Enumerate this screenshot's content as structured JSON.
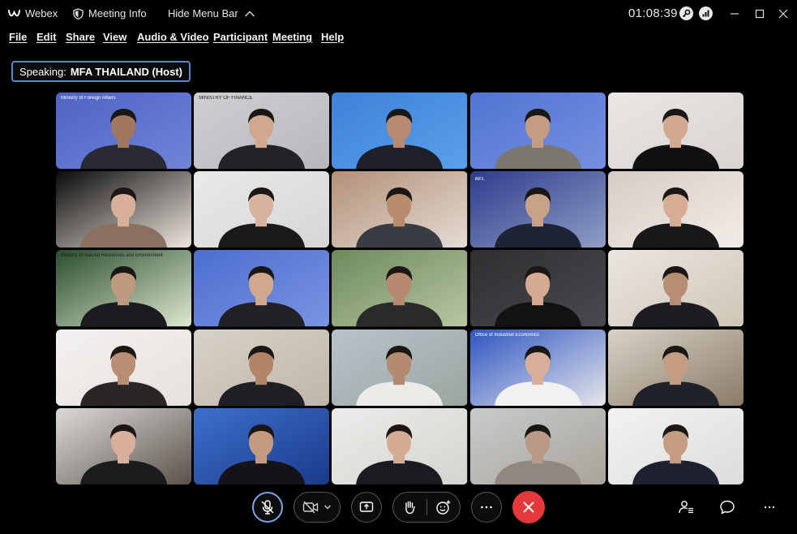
{
  "titlebar": {
    "app_name": "Webex",
    "meeting_info": "Meeting Info",
    "hide_menu_bar": "Hide Menu Bar",
    "elapsed": "01:08:39"
  },
  "menu": [
    "File",
    "Edit",
    "Share",
    "View",
    "Audio & Video",
    "Participant",
    "Meeting",
    "Help"
  ],
  "speaking": {
    "label": "Speaking:",
    "name": "MFA THAILAND (Host)"
  },
  "colors": {
    "accent": "#5b86c8",
    "end_call": "#e5383b",
    "background": "#000000"
  },
  "tiles": [
    {
      "bg": "#4f63c4",
      "bg2": "#6f85d8",
      "face": "#a07860",
      "suit": "#2a2a34",
      "banner": "Ministry of Foreign Affairs"
    },
    {
      "bg": "#cfcfd2",
      "bg2": "#b7b8bc",
      "face": "#d0a890",
      "suit": "#222228",
      "banner": "MINISTRY OF FINANCE"
    },
    {
      "bg": "#3d82d8",
      "bg2": "#5aa0ea",
      "face": "#b88a70",
      "suit": "#20202a",
      "banner": ""
    },
    {
      "bg": "#5174d2",
      "bg2": "#7590e0",
      "face": "#c49c84",
      "suit": "#7a7670",
      "banner": ""
    },
    {
      "bg": "#e9e6e4",
      "bg2": "#d8d4d0",
      "face": "#d2a890",
      "suit": "#111114",
      "banner": ""
    },
    {
      "bg": "#0a0a0a",
      "bg2": "#efe7df",
      "face": "#d8b09a",
      "suit": "#8a7060",
      "banner": ""
    },
    {
      "bg": "#e9e9ea",
      "bg2": "#d6d6d8",
      "face": "#d8b29c",
      "suit": "#1a1a1a",
      "banner": ""
    },
    {
      "bg": "#b39078",
      "bg2": "#e4dcd3",
      "face": "#b88b6c",
      "suit": "#3a3c44",
      "banner": ""
    },
    {
      "bg": "#2e3c8e",
      "bg2": "#8f9fc4",
      "face": "#c8a288",
      "suit": "#1e2434",
      "banner": "สสว."
    },
    {
      "bg": "#d6ccc4",
      "bg2": "#f2ece8",
      "face": "#d6ad94",
      "suit": "#181818",
      "banner": ""
    },
    {
      "bg": "#2a4d2e",
      "bg2": "#dde8d0",
      "face": "#c09a80",
      "suit": "#1a1c22",
      "banner": "Ministry of Natural Resources and Environment"
    },
    {
      "bg": "#4d6ed0",
      "bg2": "#7a94e2",
      "face": "#d0a88e",
      "suit": "#222226",
      "banner": ""
    },
    {
      "bg": "#6d8a5a",
      "bg2": "#b8c6a4",
      "face": "#b58a6e",
      "suit": "#2a2a2a",
      "banner": ""
    },
    {
      "bg": "#2f2f32",
      "bg2": "#4a4a4e",
      "face": "#d4aa92",
      "suit": "#121214",
      "banner": ""
    },
    {
      "bg": "#eae6e0",
      "bg2": "#cfc5b6",
      "face": "#b88e72",
      "suit": "#1c1c22",
      "banner": ""
    },
    {
      "bg": "#f3f1f0",
      "bg2": "#e5e1dd",
      "face": "#b88e74",
      "suit": "#2a2628",
      "banner": ""
    },
    {
      "bg": "#d7d2c8",
      "bg2": "#bfb6a8",
      "face": "#b28568",
      "suit": "#1e2024",
      "banner": ""
    },
    {
      "bg": "#b8c2cc",
      "bg2": "#9aa6a0",
      "face": "#b48a70",
      "suit": "#ecebe8",
      "banner": ""
    },
    {
      "bg": "#2e55c2",
      "bg2": "#e6e6ea",
      "face": "#d8b09a",
      "suit": "#f2f2f2",
      "banner": "Office of Industrial Economics"
    },
    {
      "bg": "#d8d2c8",
      "bg2": "#8a7a66",
      "face": "#c49c82",
      "suit": "#20222a",
      "banner": ""
    },
    {
      "bg": "#dcdad8",
      "bg2": "#5a524a",
      "face": "#d8b09c",
      "suit": "#1c1c1e",
      "banner": ""
    },
    {
      "bg": "#3c70cc",
      "bg2": "#1b3a8a",
      "face": "#c49a80",
      "suit": "#141418",
      "banner": ""
    },
    {
      "bg": "#ecebe9",
      "bg2": "#d6d4d0",
      "face": "#d4ac94",
      "suit": "#1a1c22",
      "banner": ""
    },
    {
      "bg": "#c7cbcc",
      "bg2": "#a9a39a",
      "face": "#b89a86",
      "suit": "#8e8880",
      "banner": ""
    },
    {
      "bg": "#f2f2f1",
      "bg2": "#dedcdb",
      "face": "#c49c80",
      "suit": "#1e2230",
      "banner": ""
    }
  ]
}
